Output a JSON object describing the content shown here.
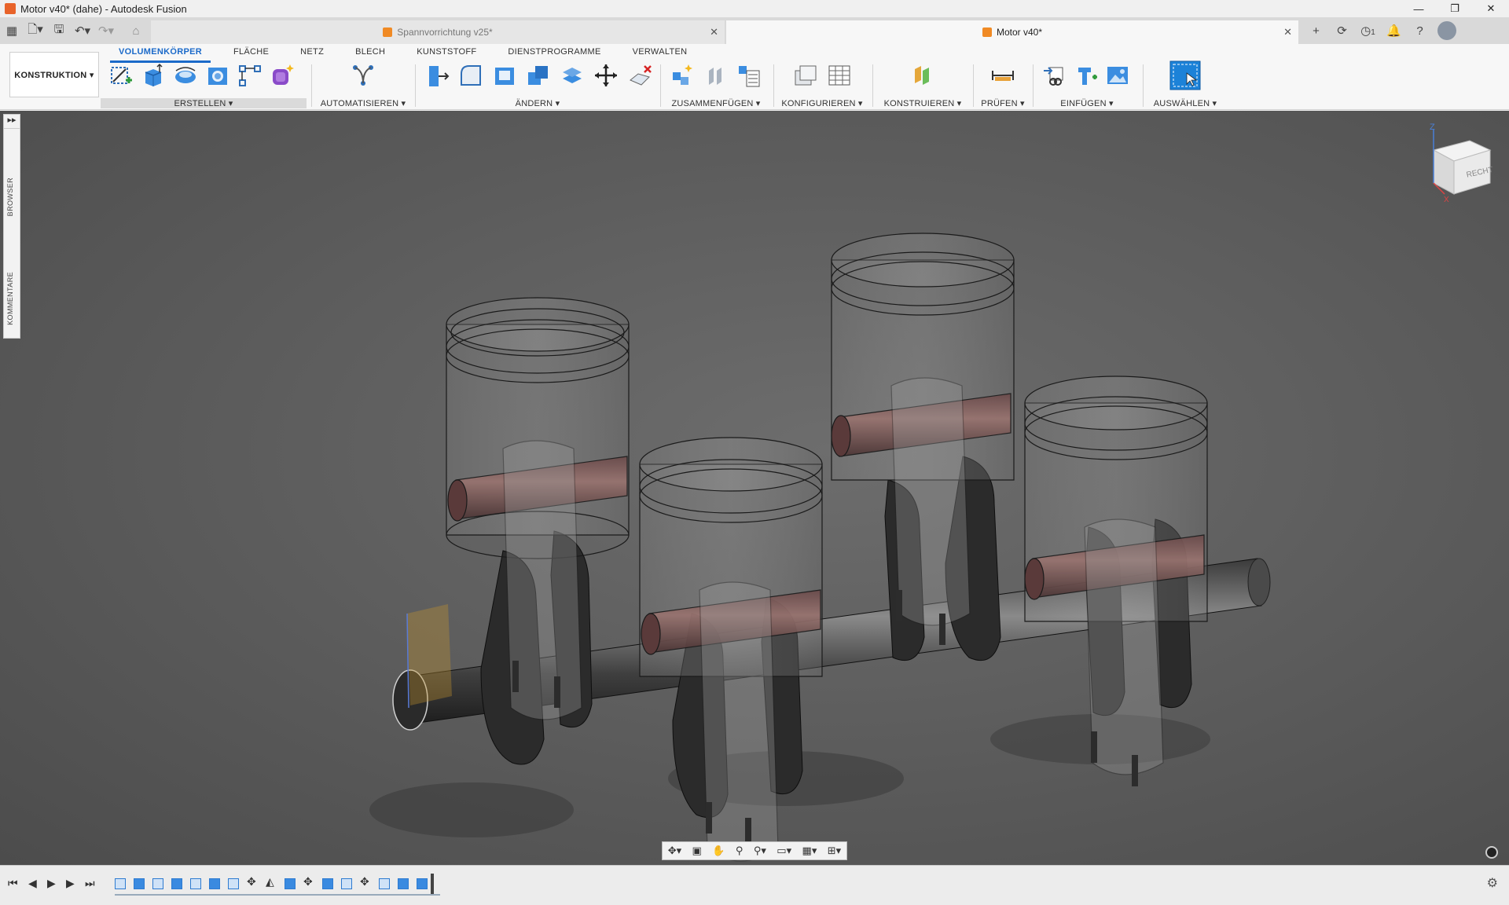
{
  "window": {
    "title": "Motor v40* (dahe) - Autodesk Fusion",
    "controls": {
      "minimize": "—",
      "restore": "❐",
      "close": "✕"
    }
  },
  "tabs": {
    "inactive": {
      "label": "Spannvorrichtung v25*",
      "close": "✕"
    },
    "active": {
      "label": "Motor v40*",
      "close": "✕"
    },
    "new_tab": "+",
    "notification_count": "1"
  },
  "ribbon": {
    "workspace": "KONSTRUKTION ▾",
    "tabs": [
      "VOLUMENKÖRPER",
      "FLÄCHE",
      "NETZ",
      "BLECH",
      "KUNSTSTOFF",
      "DIENSTPROGRAMME",
      "VERWALTEN"
    ],
    "groups": {
      "erstellen": "ERSTELLEN ▾",
      "automatisieren": "AUTOMATISIEREN ▾",
      "aendern": "ÄNDERN ▾",
      "zusammenfuegen": "ZUSAMMENFÜGEN ▾",
      "konfigurieren": "KONFIGURIEREN ▾",
      "konstruieren": "KONSTRUIEREN ▾",
      "pruefen": "PRÜFEN ▾",
      "einfuegen": "EINFÜGEN ▾",
      "auswaehlen": "AUSWÄHLEN ▾"
    }
  },
  "left_panel": {
    "expand": "▸▸",
    "browser": "BROWSER",
    "comments": "KOMMENTARE"
  },
  "viewcube": {
    "face_label": "RECHTS",
    "axis_z": "Z",
    "axis_x": "X"
  },
  "timeline": {
    "controls": [
      "⏮",
      "◀",
      "▶",
      "▶",
      "⏭"
    ]
  },
  "colors": {
    "accent": "#1b6ac9",
    "viewport_bg": "#5e5e5e",
    "ribbon_bg": "#f7f7f7",
    "part_icon": "#f08a24"
  }
}
